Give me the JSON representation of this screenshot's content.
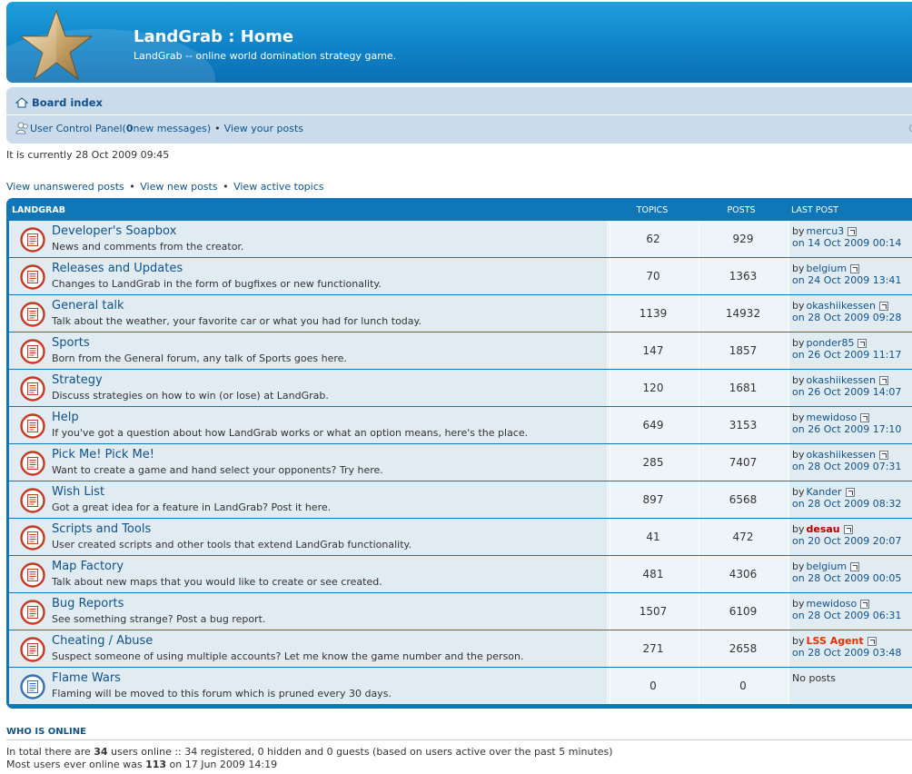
{
  "header": {
    "title": "LandGrab : Home",
    "description": "LandGrab -- online world domination strategy game."
  },
  "navbar": {
    "board_index": "Board index",
    "ucp_label": "User Control Panel",
    "ucp_open": " (",
    "new_messages_count": "0",
    "new_messages_text": " new messages)",
    "bullet": "•",
    "view_posts": "View your posts"
  },
  "current_time": "It is currently 28 Oct 2009 09:45",
  "search_links": {
    "unanswered": "View unanswered posts",
    "new_posts": "View new posts",
    "active": "View active topics",
    "bullet": "•"
  },
  "forum_table": {
    "category": "LandGrab",
    "col_topics": "Topics",
    "col_posts": "Posts",
    "col_last_post": "Last post",
    "forums": [
      {
        "title": "Developer's Soapbox",
        "desc": "News and comments from the creator.",
        "topics": "62",
        "posts": "929",
        "by": "by",
        "user": "mercu3",
        "user_style": "normal",
        "date": "on 14 Oct 2009 00:14",
        "icon": "forum-read-icon"
      },
      {
        "title": "Releases and Updates",
        "desc": "Changes to LandGrab in the form of bugfixes or new functionality.",
        "topics": "70",
        "posts": "1363",
        "by": "by",
        "user": "belgium",
        "user_style": "normal",
        "date": "on 24 Oct 2009 13:41",
        "icon": "forum-read-icon"
      },
      {
        "title": "General talk",
        "desc": "Talk about the weather, your favorite car or what you had for lunch today.",
        "topics": "1139",
        "posts": "14932",
        "by": "by",
        "user": "okashiikessen",
        "user_style": "normal",
        "date": "on 28 Oct 2009 09:28",
        "icon": "forum-read-icon"
      },
      {
        "title": "Sports",
        "desc": "Born from the General forum, any talk of Sports goes here.",
        "topics": "147",
        "posts": "1857",
        "by": "by",
        "user": "ponder85",
        "user_style": "normal",
        "date": "on 26 Oct 2009 11:17",
        "icon": "forum-read-icon"
      },
      {
        "title": "Strategy",
        "desc": "Discuss strategies on how to win (or lose) at LandGrab.",
        "topics": "120",
        "posts": "1681",
        "by": "by",
        "user": "okashiikessen",
        "user_style": "normal",
        "date": "on 26 Oct 2009 14:07",
        "icon": "forum-read-icon"
      },
      {
        "title": "Help",
        "desc": "If you've got a question about how LandGrab works or what an option means, here's the place.",
        "topics": "649",
        "posts": "3153",
        "by": "by",
        "user": "mewidoso",
        "user_style": "normal",
        "date": "on 26 Oct 2009 17:10",
        "icon": "forum-read-icon"
      },
      {
        "title": "Pick Me! Pick Me!",
        "desc": "Want to create a game and hand select your opponents? Try here.",
        "topics": "285",
        "posts": "7407",
        "by": "by",
        "user": "okashiikessen",
        "user_style": "normal",
        "date": "on 28 Oct 2009 07:31",
        "icon": "forum-read-icon"
      },
      {
        "title": "Wish List",
        "desc": "Got a great idea for a feature in LandGrab? Post it here.",
        "topics": "897",
        "posts": "6568",
        "by": "by",
        "user": "Kander",
        "user_style": "normal",
        "date": "on 28 Oct 2009 08:32",
        "icon": "forum-read-icon"
      },
      {
        "title": "Scripts and Tools",
        "desc": "User created scripts and other tools that extend LandGrab functionality.",
        "topics": "41",
        "posts": "472",
        "by": "by",
        "user": "desau",
        "user_style": "mod",
        "date": "on 20 Oct 2009 20:07",
        "icon": "forum-read-icon"
      },
      {
        "title": "Map Factory",
        "desc": "Talk about new maps that you would like to create or see created.",
        "topics": "481",
        "posts": "4306",
        "by": "by",
        "user": "belgium",
        "user_style": "normal",
        "date": "on 28 Oct 2009 00:05",
        "icon": "forum-read-icon"
      },
      {
        "title": "Bug Reports",
        "desc": "See something strange? Post a bug report.",
        "topics": "1507",
        "posts": "6109",
        "by": "by",
        "user": "mewidoso",
        "user_style": "normal",
        "date": "on 28 Oct 2009 06:31",
        "icon": "forum-read-icon"
      },
      {
        "title": "Cheating / Abuse",
        "desc": "Suspect someone of using multiple accounts? Let me know the game number and the person.",
        "topics": "271",
        "posts": "2658",
        "by": "by",
        "user": "LSS Agent",
        "user_style": "admin",
        "date": "on 28 Oct 2009 03:48",
        "icon": "forum-read-icon"
      },
      {
        "title": "Flame Wars",
        "desc": "Flaming will be moved to this forum which is pruned every 30 days.",
        "topics": "0",
        "posts": "0",
        "no_posts": "No posts",
        "icon": "forum-empty-icon"
      }
    ]
  },
  "who_is_online": {
    "title": "Who is online",
    "line1_a": "In total there are ",
    "line1_count": "34",
    "line1_b": " users online :: 34 registered, 0 hidden and 0 guests (based on users active over the past 5 minutes)",
    "line2_a": "Most users ever online was ",
    "line2_count": "113",
    "line2_b": " on 17 Jun 2009 14:19"
  },
  "colors": {
    "accent_blue": "#0f76b8",
    "link": "#105289",
    "row_bg": "#e1ebf2",
    "unread_red": "#c43a22",
    "read_blue": "#3a6fb0"
  }
}
